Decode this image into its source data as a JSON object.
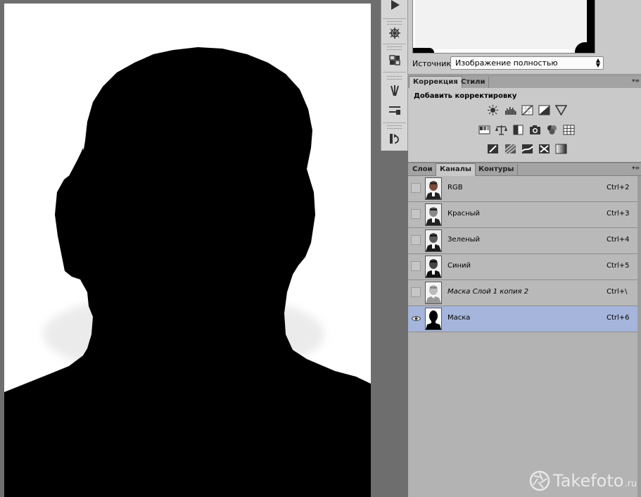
{
  "navigator": {
    "source_label": "Источник:",
    "source_value": "Изображение полностью"
  },
  "adjustments_panel": {
    "tabs": [
      {
        "label": "Коррекция",
        "active": true
      },
      {
        "label": "Стили",
        "active": false
      }
    ],
    "heading": "Добавить корректировку"
  },
  "channels_panel": {
    "tabs": [
      {
        "label": "Слои",
        "active": false
      },
      {
        "label": "Каналы",
        "active": true
      },
      {
        "label": "Контуры",
        "active": false
      }
    ],
    "channels": [
      {
        "name": "RGB",
        "shortcut": "Ctrl+2",
        "visible": false,
        "selected": false,
        "italic": false
      },
      {
        "name": "Красный",
        "shortcut": "Ctrl+3",
        "visible": false,
        "selected": false,
        "italic": false
      },
      {
        "name": "Зеленый",
        "shortcut": "Ctrl+4",
        "visible": false,
        "selected": false,
        "italic": false
      },
      {
        "name": "Синий",
        "shortcut": "Ctrl+5",
        "visible": false,
        "selected": false,
        "italic": false
      },
      {
        "name": "Маска Слой 1 копия 2",
        "shortcut": "Ctrl+\\",
        "visible": false,
        "selected": false,
        "italic": true
      },
      {
        "name": "Маска",
        "shortcut": "Ctrl+6",
        "visible": true,
        "selected": true,
        "italic": false
      }
    ]
  },
  "watermark": {
    "brand": "Takefoto",
    "domain": ".ru"
  },
  "colors": {
    "selected_row": "#a5b5dc",
    "workspace": "#6e6e6e",
    "panel": "#c9c9c9"
  }
}
